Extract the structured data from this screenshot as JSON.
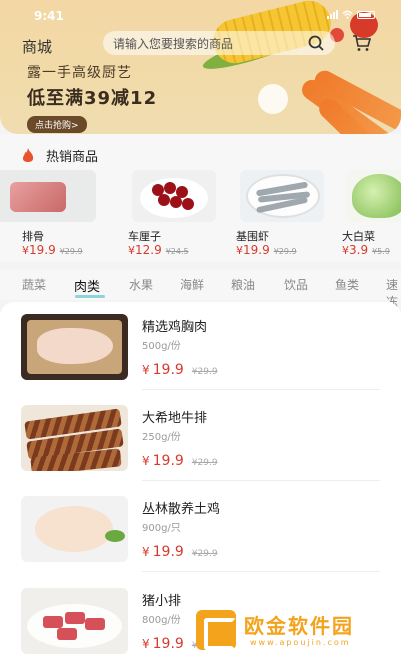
{
  "status": {
    "time": "9:41"
  },
  "header": {
    "title": "商城",
    "search_placeholder": "请输入您要搜索的商品"
  },
  "banner": {
    "line1": "露一手高级厨艺",
    "line2": "低至满39减12",
    "button": "点击抢购>"
  },
  "hot": {
    "title": "热销商品",
    "items": [
      {
        "name": "排骨",
        "price": "19.9",
        "old": "¥29.9"
      },
      {
        "name": "车厘子",
        "price": "12.9",
        "old": "¥24.5"
      },
      {
        "name": "基围虾",
        "price": "19.9",
        "old": "¥29.9"
      },
      {
        "name": "大白菜",
        "price": "3.9",
        "old": "¥5.9"
      }
    ]
  },
  "tabs": [
    "蔬菜",
    "肉类",
    "水果",
    "海鲜",
    "粮油",
    "饮品",
    "鱼类",
    "速冻"
  ],
  "active_tab": "肉类",
  "products": [
    {
      "name": "精选鸡胸肉",
      "spec": "500g/份",
      "price": "19.9",
      "old": "¥29.9"
    },
    {
      "name": "大希地牛排",
      "spec": "250g/份",
      "price": "19.9",
      "old": "¥29.9"
    },
    {
      "name": "丛林散养土鸡",
      "spec": "900g/只",
      "price": "19.9",
      "old": "¥29.9"
    },
    {
      "name": "猪小排",
      "spec": "800g/份",
      "price": "19.9",
      "old": "¥29.9"
    }
  ],
  "currency": "¥",
  "watermark": {
    "text": "欧金软件园",
    "url": "www.apoujin.com"
  },
  "colors": {
    "price": "#d63a2c",
    "banner": "#f1dba9",
    "tab_underline": "#8ed4da",
    "watermark": "#f3a31c"
  }
}
